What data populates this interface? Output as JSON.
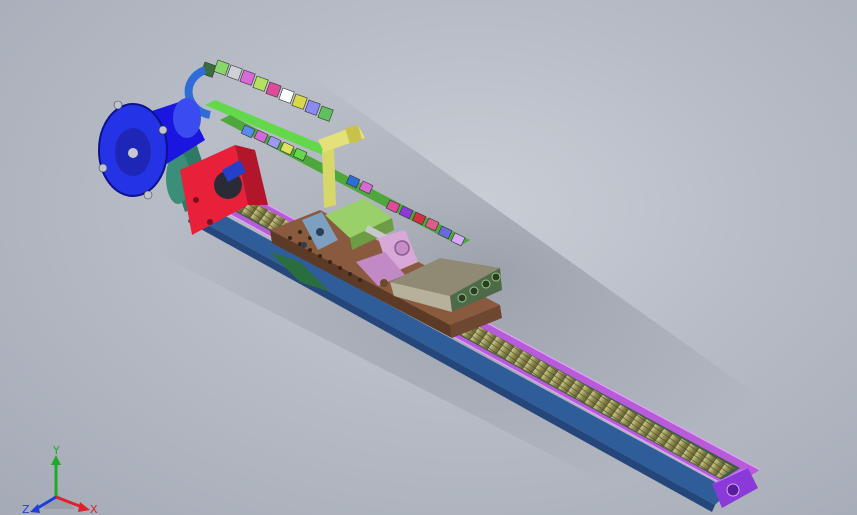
{
  "view": {
    "background_center": "#c9ced6",
    "background_edge": "#a5abb6"
  },
  "triad": {
    "x_label": "X",
    "y_label": "Y",
    "z_label": "Z",
    "x_color": "#e0202a",
    "y_color": "#1faa2a",
    "z_color": "#1e3fd8"
  },
  "model": {
    "parts": [
      {
        "name": "servo-motor",
        "color": "#1a16e0"
      },
      {
        "name": "motor-flange",
        "color": "#2433e6"
      },
      {
        "name": "coupling",
        "color": "#2f7a66"
      },
      {
        "name": "end-plate",
        "color": "#e8203a"
      },
      {
        "name": "base-rail",
        "color": "#2f5d99"
      },
      {
        "name": "rail-edge",
        "color": "#b85bd8"
      },
      {
        "name": "guide-channel",
        "color": "#3d5d47"
      },
      {
        "name": "ball-screw",
        "color": "#9c9b5a"
      },
      {
        "name": "carriage-plate",
        "color": "#8a5a3e"
      },
      {
        "name": "cylinder",
        "color": "#9ad06a"
      },
      {
        "name": "clevis-bracket",
        "color": "#d8a8d8"
      },
      {
        "name": "tool-block",
        "color": "#8f8a74"
      },
      {
        "name": "cable-chain-support",
        "color": "#62d84a"
      },
      {
        "name": "bracket-post",
        "color": "#d8d86a"
      },
      {
        "name": "end-cap",
        "color": "#8a3ad8"
      }
    ]
  }
}
